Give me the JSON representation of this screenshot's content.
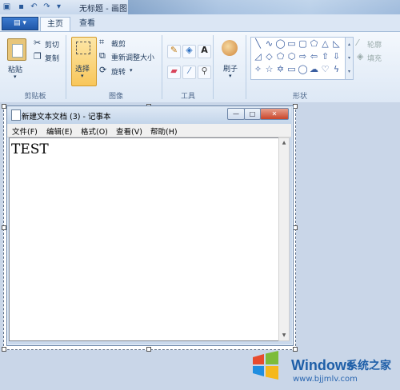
{
  "window": {
    "title": "无标题 - 画图"
  },
  "ribbon_tabs": {
    "app_menu_icon": "app-menu-icon",
    "home": "主页",
    "view": "查看"
  },
  "clipboard": {
    "paste": "粘贴",
    "cut": "剪切",
    "copy": "复制",
    "group": "剪贴板"
  },
  "image": {
    "select": "选择",
    "crop": "裁剪",
    "resize": "重新调整大小",
    "rotate": "旋转",
    "group": "图像"
  },
  "tools": {
    "group": "工具"
  },
  "brushes": {
    "label": "刷子"
  },
  "shapes": {
    "outline": "轮廓",
    "fill": "填充",
    "group": "形状"
  },
  "notepad": {
    "title": "新建文本文档 (3) - 记事本",
    "min_glyph": "—",
    "max_glyph": "□",
    "close_glyph": "✕",
    "menus": [
      "文件(F)",
      "编辑(E)",
      "格式(O)",
      "查看(V)",
      "帮助(H)"
    ],
    "content": "TEST"
  },
  "watermark": {
    "brand": "Windows",
    "cn": "系统之家",
    "url": "www.bjjmlv.com"
  },
  "colors": {
    "accent": "#1f5fa8",
    "ribbon": "#dde8f5",
    "select_active": "#f8c65a"
  }
}
